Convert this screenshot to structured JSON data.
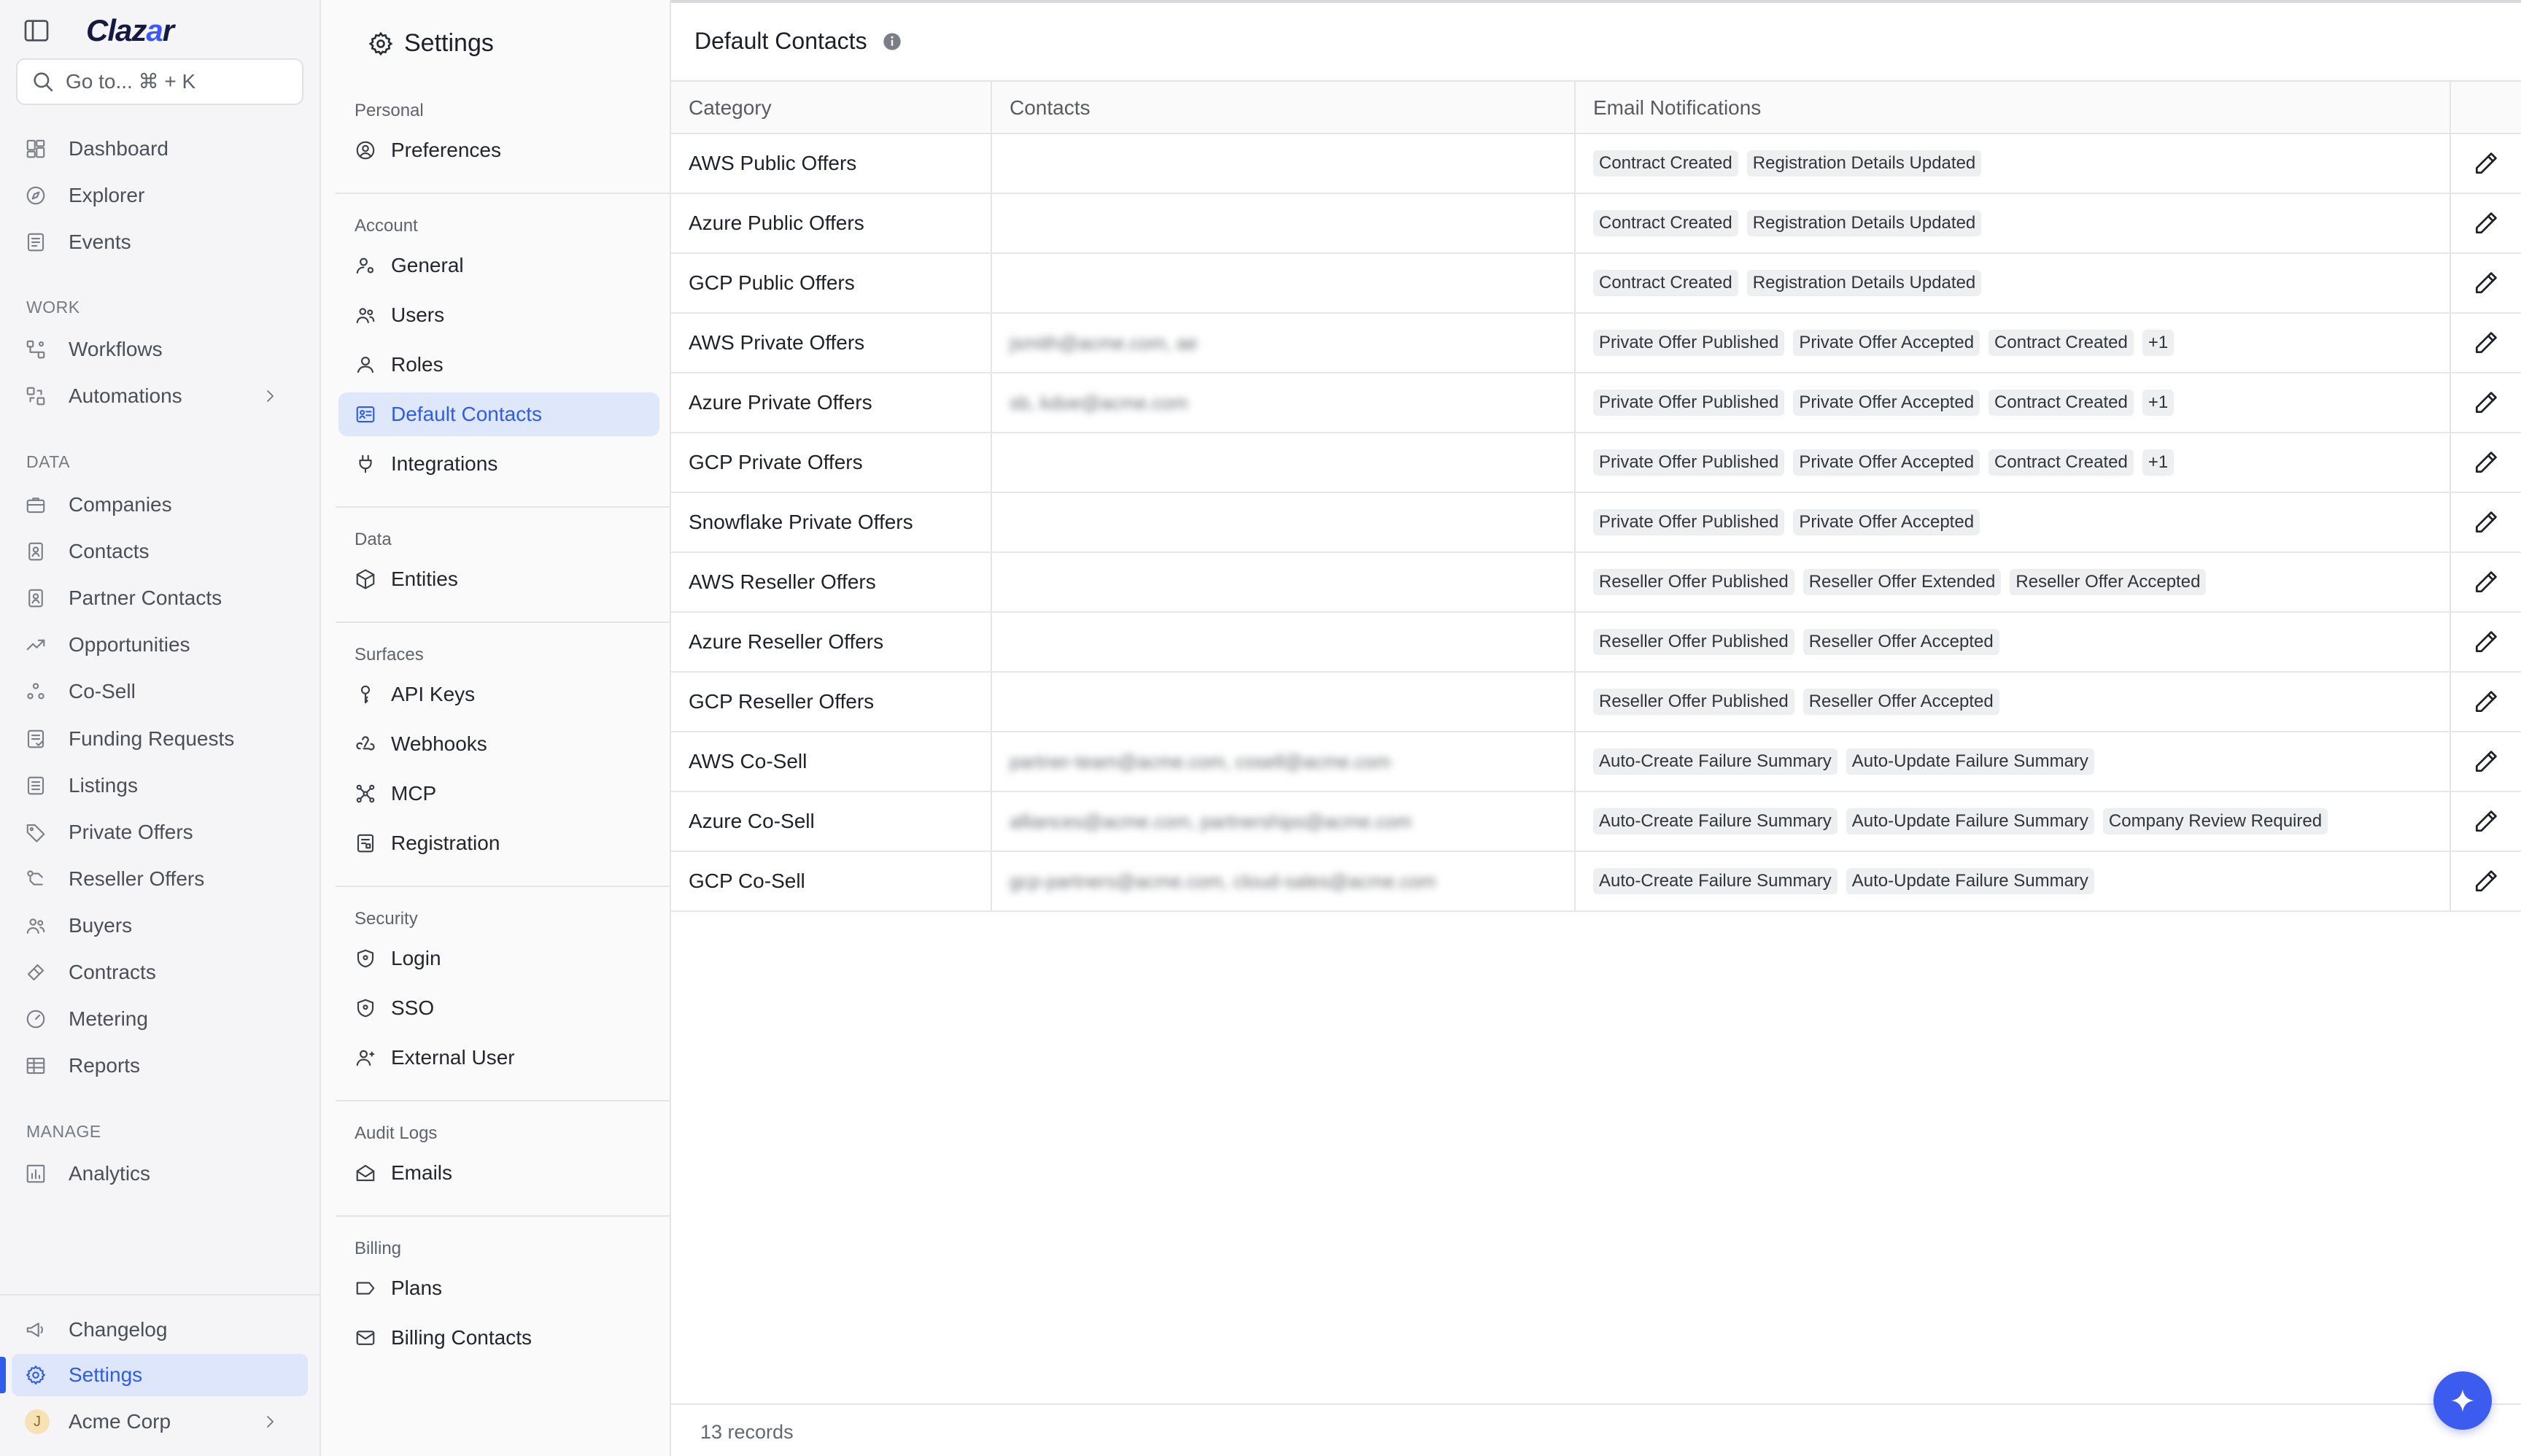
{
  "app": {
    "logo_text": "Clazar",
    "accent": "#2f5ce9",
    "search_placeholder": "Go to... ⌘ + K"
  },
  "nav": {
    "top": [
      {
        "label": "Dashboard",
        "icon": "dashboard-icon"
      },
      {
        "label": "Explorer",
        "icon": "compass-icon"
      },
      {
        "label": "Events",
        "icon": "events-icon"
      }
    ],
    "work_label": "WORK",
    "work": [
      {
        "label": "Workflows",
        "icon": "workflow-icon"
      },
      {
        "label": "Automations",
        "icon": "automation-icon"
      }
    ],
    "data_label": "DATA",
    "data": [
      {
        "label": "Companies",
        "icon": "briefcase-icon"
      },
      {
        "label": "Contacts",
        "icon": "contact-card-icon"
      },
      {
        "label": "Partner Contacts",
        "icon": "contact-card-icon"
      },
      {
        "label": "Opportunities",
        "icon": "trend-icon"
      },
      {
        "label": "Co-Sell",
        "icon": "cosell-icon"
      },
      {
        "label": "Funding Requests",
        "icon": "funding-icon"
      },
      {
        "label": "Listings",
        "icon": "list-icon"
      },
      {
        "label": "Private Offers",
        "icon": "tag-icon"
      },
      {
        "label": "Reseller Offers",
        "icon": "reseller-icon"
      },
      {
        "label": "Buyers",
        "icon": "users-icon"
      },
      {
        "label": "Contracts",
        "icon": "contract-icon"
      },
      {
        "label": "Metering",
        "icon": "gauge-icon"
      },
      {
        "label": "Reports",
        "icon": "table-icon"
      }
    ],
    "manage_label": "MANAGE",
    "manage": [
      {
        "label": "Analytics",
        "icon": "chart-icon"
      }
    ],
    "bottom": [
      {
        "label": "Changelog",
        "icon": "megaphone-icon"
      },
      {
        "label": "Settings",
        "icon": "gear-icon"
      }
    ],
    "org": {
      "avatar_letter": "J",
      "label": "Acme Corp"
    }
  },
  "settings_panel": {
    "title": "Settings",
    "sections": [
      {
        "label": "Personal",
        "items": [
          "Preferences"
        ]
      },
      {
        "label": "Account",
        "items": [
          "General",
          "Users",
          "Roles",
          "Default Contacts",
          "Integrations"
        ]
      },
      {
        "label": "Data",
        "items": [
          "Entities"
        ]
      },
      {
        "label": "Surfaces",
        "items": [
          "API Keys",
          "Webhooks",
          "MCP",
          "Registration"
        ]
      },
      {
        "label": "Security",
        "items": [
          "Login",
          "SSO",
          "External User"
        ]
      },
      {
        "label": "Audit Logs",
        "items": [
          "Emails"
        ]
      },
      {
        "label": "Billing",
        "items": [
          "Plans",
          "Billing Contacts"
        ]
      }
    ],
    "active_item": "Default Contacts"
  },
  "main": {
    "title": "Default Contacts",
    "columns": [
      "Category",
      "Contacts",
      "Email Notifications"
    ],
    "rows": [
      {
        "category": "AWS Public Offers",
        "contacts": "",
        "notifications": [
          "Contract Created",
          "Registration Details Updated"
        ]
      },
      {
        "category": "Azure Public Offers",
        "contacts": "",
        "notifications": [
          "Contract Created",
          "Registration Details Updated"
        ]
      },
      {
        "category": "GCP Public Offers",
        "contacts": "",
        "notifications": [
          "Contract Created",
          "Registration Details Updated"
        ]
      },
      {
        "category": "AWS Private Offers",
        "contacts": "jsmith@acme.com, ae",
        "notifications": [
          "Private Offer Published",
          "Private Offer Accepted",
          "Contract Created",
          "+1"
        ]
      },
      {
        "category": "Azure Private Offers",
        "contacts": "sb, kdoe@acme.com",
        "notifications": [
          "Private Offer Published",
          "Private Offer Accepted",
          "Contract Created",
          "+1"
        ]
      },
      {
        "category": "GCP Private Offers",
        "contacts": "",
        "notifications": [
          "Private Offer Published",
          "Private Offer Accepted",
          "Contract Created",
          "+1"
        ]
      },
      {
        "category": "Snowflake Private Offers",
        "contacts": "",
        "notifications": [
          "Private Offer Published",
          "Private Offer Accepted"
        ]
      },
      {
        "category": "AWS Reseller Offers",
        "contacts": "",
        "notifications": [
          "Reseller Offer Published",
          "Reseller Offer Extended",
          "Reseller Offer Accepted"
        ]
      },
      {
        "category": "Azure Reseller Offers",
        "contacts": "",
        "notifications": [
          "Reseller Offer Published",
          "Reseller Offer Accepted"
        ]
      },
      {
        "category": "GCP Reseller Offers",
        "contacts": "",
        "notifications": [
          "Reseller Offer Published",
          "Reseller Offer Accepted"
        ]
      },
      {
        "category": "AWS Co-Sell",
        "contacts": "partner-team@acme.com, cosell@acme.com",
        "notifications": [
          "Auto-Create Failure Summary",
          "Auto-Update Failure Summary"
        ]
      },
      {
        "category": "Azure Co-Sell",
        "contacts": "alliances@acme.com, partnerships@acme.com",
        "notifications": [
          "Auto-Create Failure Summary",
          "Auto-Update Failure Summary",
          "Company Review Required"
        ]
      },
      {
        "category": "GCP Co-Sell",
        "contacts": "gcp-partners@acme.com, cloud-sales@acme.com",
        "notifications": [
          "Auto-Create Failure Summary",
          "Auto-Update Failure Summary"
        ]
      }
    ],
    "record_count": "13 records"
  }
}
